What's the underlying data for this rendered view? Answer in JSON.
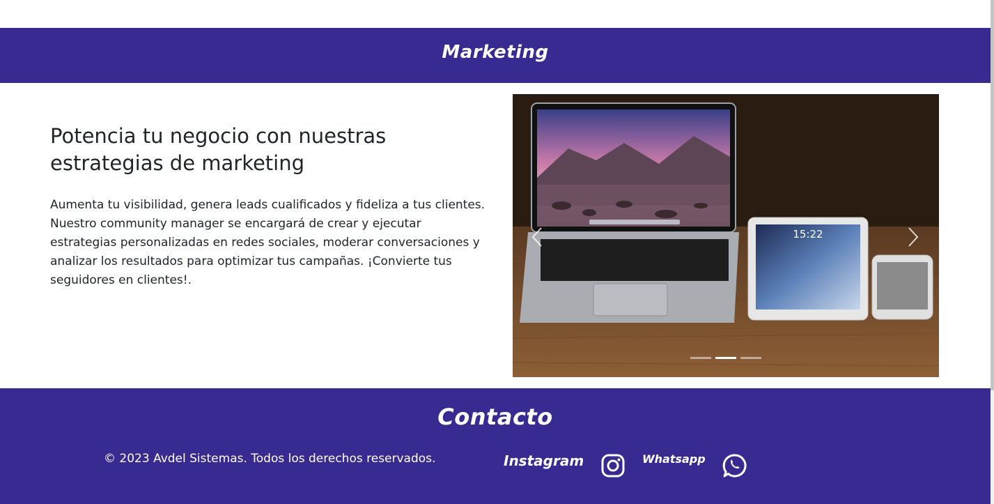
{
  "marketing": {
    "title": "Marketing",
    "headline": "Potencia tu negocio con nuestras estrategias de marketing",
    "description": "Aumenta tu visibilidad, genera leads cualificados y fideliza a tus clientes. Nuestro community manager se encargará de crear y ejecutar estrategias personalizadas en redes sociales, moderar conversaciones y analizar los resultados para optimizar tus campañas. ¡Convierte tus seguidores en clientes!."
  },
  "carousel": {
    "slide_count": 3,
    "active_index": 1,
    "laptop_time": "15:22",
    "prev_icon": "chevron-left-icon",
    "next_icon": "chevron-right-icon"
  },
  "footer": {
    "title": "Contacto",
    "copyright": "© 2023 Avdel Sistemas. Todos los derechos reservados.",
    "social": {
      "instagram_label": "Instagram",
      "instagram_icon": "instagram-icon",
      "whatsapp_label": "Whatsapp",
      "whatsapp_icon": "whatsapp-icon"
    }
  },
  "colors": {
    "brand": "#372b91",
    "text": "#212529",
    "on_brand": "#ffffff"
  }
}
